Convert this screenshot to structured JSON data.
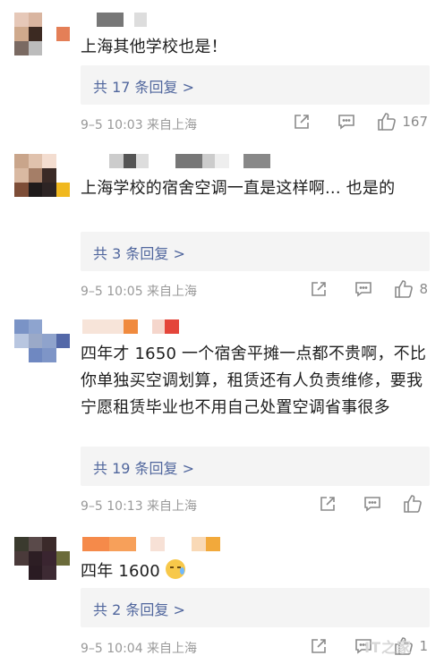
{
  "comments": [
    {
      "text": "上海其他学校也是！",
      "reply": "共 17 条回复 >",
      "meta": "9–5 10:03  来自上海",
      "likes": "167"
    },
    {
      "text": "上海学校的宿舍空调一直是这样啊...     也是的",
      "reply": "共 3 条回复 >",
      "meta": "9–5 10:05  来自上海",
      "likes": "8"
    },
    {
      "text": "四年才 1650 一个宿舍平摊一点都不贵啊，不比你单独买空调划算，租赁还有人负责维修，要我宁愿租赁毕业也不用自己处置空调省事很多",
      "reply": "共 19 条回复 >",
      "meta": "9–5 10:13  来自上海",
      "likes": ""
    },
    {
      "text": "四年 1600",
      "reply": "共 2 条回复 >",
      "meta": "9–5 10:04  来自上海",
      "likes": "1"
    }
  ],
  "icons": {
    "share": "share-icon",
    "reply": "comment-icon",
    "like": "thumbs-up-icon",
    "emoji": "sweat-emoji-icon"
  },
  "colors": {
    "link": "#50669d",
    "meta": "#999999",
    "reply_bg": "#f4f4f4"
  },
  "watermark": "IT之家"
}
